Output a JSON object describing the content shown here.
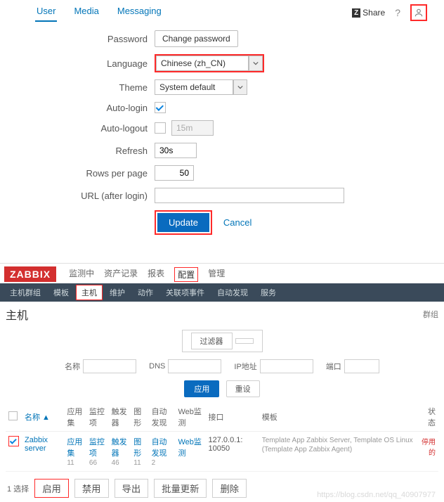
{
  "header": {
    "tabs": {
      "user": "User",
      "media": "Media",
      "messaging": "Messaging"
    },
    "share": "Share",
    "help": "?"
  },
  "form": {
    "password_label": "Password",
    "change_password": "Change password",
    "language_label": "Language",
    "language_value": "Chinese (zh_CN)",
    "theme_label": "Theme",
    "theme_value": "System default",
    "autologin_label": "Auto-login",
    "autologout_label": "Auto-logout",
    "autologout_value": "15m",
    "refresh_label": "Refresh",
    "refresh_value": "30s",
    "rows_label": "Rows per page",
    "rows_value": "50",
    "url_label": "URL (after login)",
    "url_value": "",
    "update": "Update",
    "cancel": "Cancel"
  },
  "zbx": {
    "logo": "ZABBIX",
    "menu": {
      "mon": "监测中",
      "inv": "资产记录",
      "rep": "报表",
      "cfg": "配置",
      "adm": "管理"
    },
    "submenu": {
      "hostgroups": "主机群组",
      "templates": "模板",
      "hosts": "主机",
      "maint": "维护",
      "actions": "动作",
      "corr": "关联项事件",
      "disc": "自动发现",
      "svc": "服务"
    },
    "title": "主机",
    "group_label": "群组",
    "filter_toggle": "过滤器",
    "filters": {
      "name": "名称",
      "dns": "DNS",
      "ip": "IP地址",
      "port": "端口"
    },
    "apply": "应用",
    "reset": "重设",
    "cols": {
      "name": "名称",
      "apps": "应用集",
      "items": "监控项",
      "triggers": "触发器",
      "graphs": "图形",
      "disc": "自动发现",
      "web": "Web监测",
      "iface": "接口",
      "tmpl": "模板",
      "status": "状态"
    },
    "row": {
      "name": "Zabbix server",
      "apps_l": "应用集",
      "apps_n": "11",
      "items_l": "监控项",
      "items_n": "66",
      "trig_l": "触发器",
      "trig_n": "46",
      "graph_l": "图形",
      "graph_n": "11",
      "disc_l": "自动发现",
      "disc_n": "2",
      "web_l": "Web监测",
      "iface": "127.0.0.1: 10050",
      "tmpl": "Template App Zabbix Server, Template OS Linux (Template App Zabbix Agent)",
      "status": "停用的"
    },
    "bulk": {
      "selected": "1 选择",
      "enable": "启用",
      "disable": "禁用",
      "export": "导出",
      "massupdate": "批量更新",
      "delete": "删除"
    },
    "watermark": "https://blog.csdn.net/qq_40907977"
  }
}
